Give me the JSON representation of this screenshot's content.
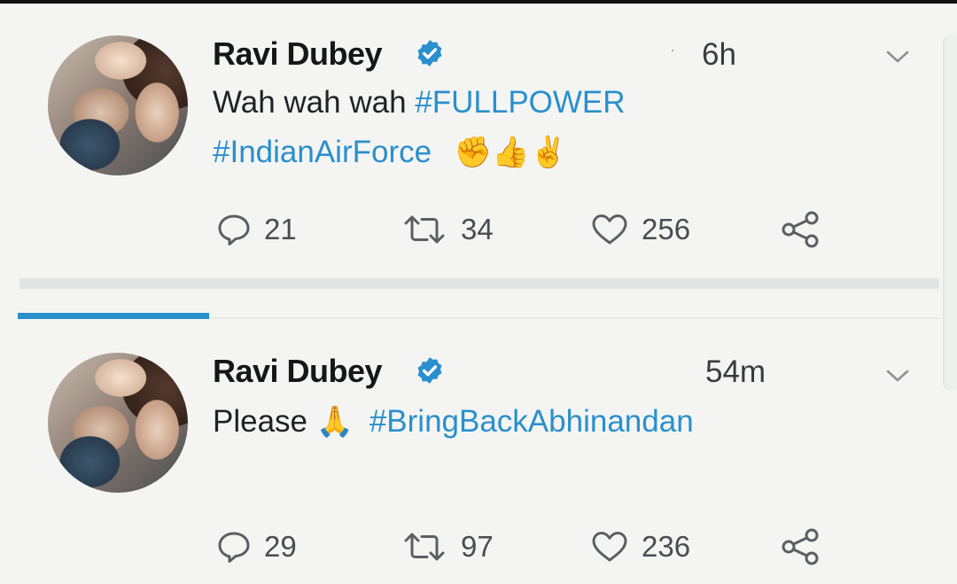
{
  "tweets": [
    {
      "author": "Ravi Dubey",
      "time": "6h",
      "line1_text": "Wah wah wah ",
      "line1_tag": "#FULLPOWER",
      "line2_tag": "#IndianAirForce",
      "emojis": [
        "✊",
        "👍",
        "✌"
      ],
      "replies": "21",
      "retweets": "34",
      "likes": "256"
    },
    {
      "author": "Ravi Dubey",
      "time": "54m",
      "line1_text": "Please ",
      "emoji": "🙏",
      "line1_tag": "#BringBackAbhinandan",
      "replies": "29",
      "retweets": "97",
      "likes": "236"
    }
  ],
  "colors": {
    "hashtag": "#2a8fcd",
    "verified": "#2a8fcd",
    "tab_underline": "#2a8fcd",
    "emoji_gold": "#f4a623"
  },
  "icons": [
    "avatar",
    "verified-icon",
    "chevron-down-icon",
    "reply-icon",
    "retweet-icon",
    "like-icon",
    "share-icon"
  ]
}
